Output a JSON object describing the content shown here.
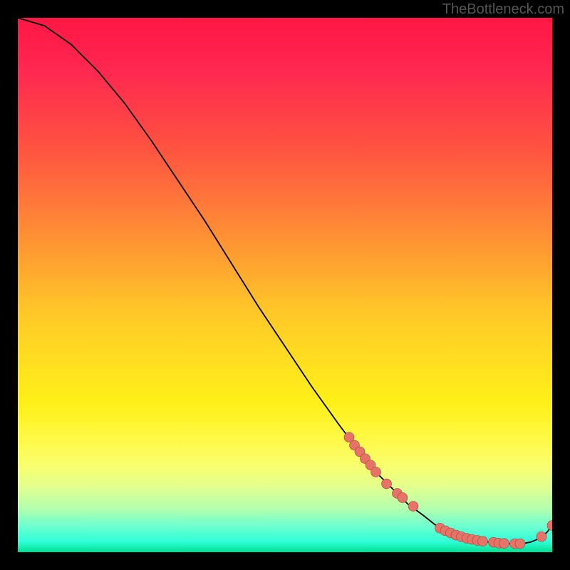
{
  "watermark": "TheBottleneck.com",
  "chart_data": {
    "type": "line",
    "title": "",
    "xlabel": "",
    "ylabel": "",
    "xlim": [
      0,
      100
    ],
    "ylim": [
      0,
      100
    ],
    "series": [
      {
        "name": "curve",
        "x": [
          0,
          5,
          10,
          15,
          20,
          25,
          30,
          35,
          40,
          45,
          50,
          55,
          60,
          63,
          65,
          67,
          70,
          73,
          76,
          78,
          80,
          82,
          84,
          86,
          88,
          90,
          92,
          93.5,
          95,
          96,
          97,
          98,
          99,
          100
        ],
        "y": [
          100,
          98.5,
          95,
          90,
          84,
          77,
          69.5,
          62,
          54,
          46,
          38.5,
          31,
          24,
          20,
          17.5,
          15,
          12,
          9,
          6.8,
          5.2,
          4,
          3.2,
          2.6,
          2.2,
          1.9,
          1.7,
          1.6,
          1.6,
          1.7,
          1.9,
          2.3,
          2.9,
          3.7,
          5
        ]
      },
      {
        "name": "dots",
        "x": [
          62,
          63,
          64,
          65,
          66,
          67,
          69,
          71,
          72,
          74,
          79,
          80,
          81,
          82,
          83,
          84,
          85,
          86,
          87,
          89,
          90,
          91,
          93,
          94,
          98,
          100
        ],
        "y": [
          21.5,
          20,
          18.8,
          17.5,
          16.3,
          15,
          12.8,
          11,
          10.2,
          8.6,
          4.5,
          4,
          3.6,
          3.2,
          2.9,
          2.6,
          2.4,
          2.2,
          2.05,
          1.85,
          1.7,
          1.65,
          1.6,
          1.6,
          2.9,
          5
        ]
      }
    ]
  }
}
